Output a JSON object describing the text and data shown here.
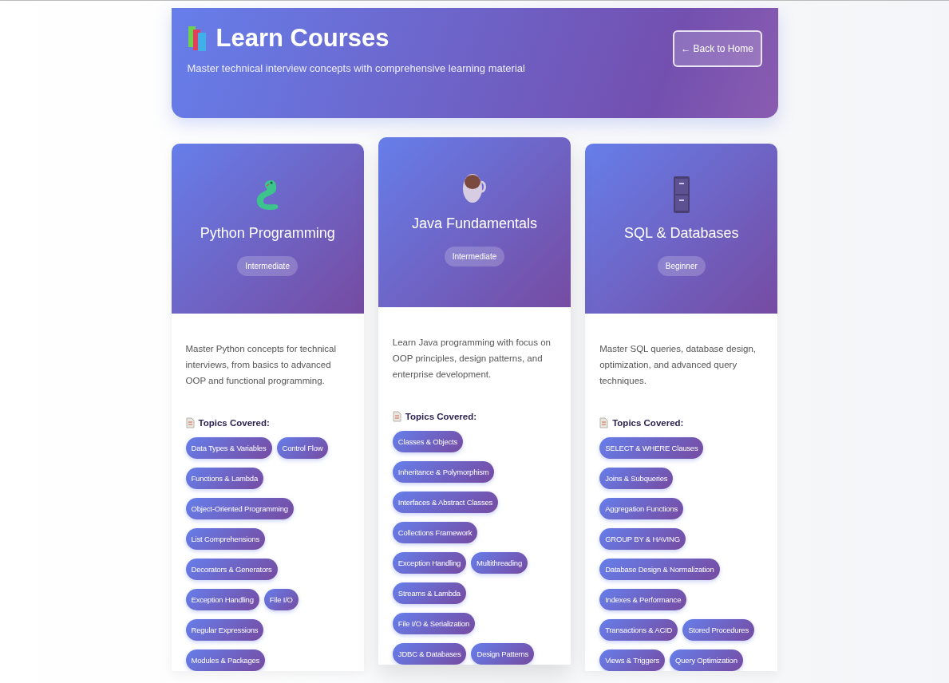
{
  "header": {
    "title": "Learn Courses",
    "subtitle": "Master technical interview concepts with comprehensive learning material",
    "back_button": "← Back to Home"
  },
  "courses": [
    {
      "kind": "snake",
      "title": "Python Programming",
      "level": "Intermediate",
      "hovered": false,
      "description": "Master Python concepts for technical interviews, from basics to advanced OOP and functional programming.",
      "topics_heading": "Topics Covered:",
      "topic_rows": [
        [
          "Data Types & Variables",
          "Control Flow"
        ],
        [
          "Functions & Lambda"
        ],
        [
          "Object-Oriented Programming"
        ],
        [
          "List Comprehensions"
        ],
        [
          "Decorators & Generators"
        ],
        [
          "Exception Handling",
          "File I/O"
        ],
        [
          "Regular Expressions"
        ],
        [
          "Modules & Packages"
        ]
      ]
    },
    {
      "kind": "cup",
      "title": "Java Fundamentals",
      "level": "Intermediate",
      "hovered": true,
      "description": "Learn Java programming with focus on OOP principles, design patterns, and enterprise development.",
      "topics_heading": "Topics Covered:",
      "topic_rows": [
        [
          "Classes & Objects"
        ],
        [
          "Inheritance & Polymorphism"
        ],
        [
          "Interfaces & Abstract Classes"
        ],
        [
          "Collections Framework"
        ],
        [
          "Exception Handling",
          "Multithreading"
        ],
        [
          "Streams & Lambda"
        ],
        [
          "File I/O & Serialization"
        ],
        [
          "JDBC & Databases",
          "Design Patterns"
        ]
      ]
    },
    {
      "kind": "cabinet",
      "title": "SQL & Databases",
      "level": "Beginner",
      "hovered": false,
      "description": "Master SQL queries, database design, optimization, and advanced query techniques.",
      "topics_heading": "Topics Covered:",
      "topic_rows": [
        [
          "SELECT & WHERE Clauses"
        ],
        [
          "Joins & Subqueries"
        ],
        [
          "Aggregation Functions"
        ],
        [
          "GROUP BY & HAVING"
        ],
        [
          "Database Design & Normalization"
        ],
        [
          "Indexes & Performance"
        ],
        [
          "Transactions & ACID",
          "Stored Procedures"
        ],
        [
          "Views & Triggers",
          "Query Optimization"
        ]
      ]
    }
  ]
}
